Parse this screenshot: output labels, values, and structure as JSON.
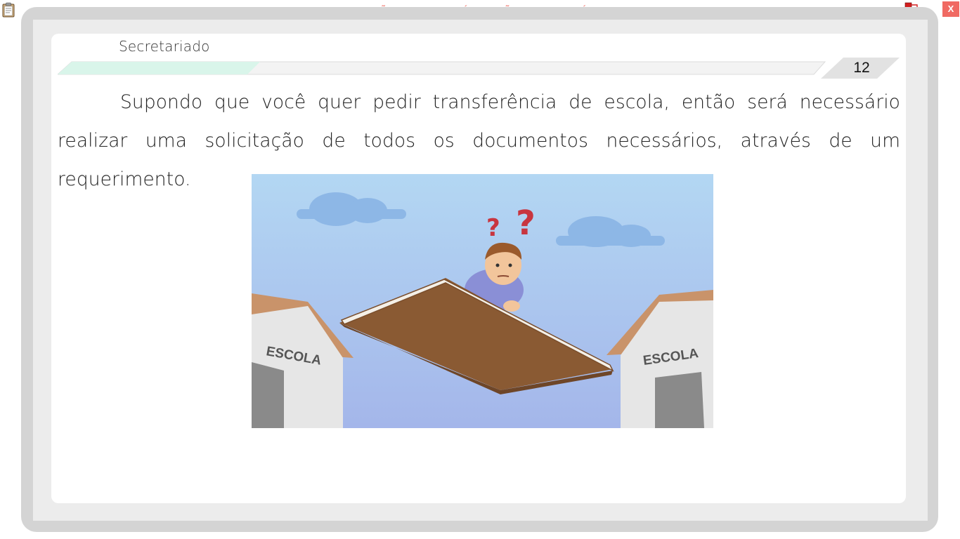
{
  "window": {
    "watermark": "VERSÃO PARA FUNCIONÁRIOS - NÃO COMERCIALIZÁVEL",
    "close_label": "X",
    "icons": [
      "clipboard-icon",
      "network-icon"
    ]
  },
  "page": {
    "subject": "Secretariado",
    "page_number": "12",
    "paragraph": "Supondo que você quer pedir transferência de escola, então será necessário realizar uma solicitação de todos os documentos necessários, através de um requerimento.",
    "illustration": {
      "left_building_label": "ESCOLA",
      "right_building_label": "ESCOLA",
      "question_marks": "? ?"
    }
  },
  "colors": {
    "accent_mint": "#d9f5ea",
    "watermark_red": "#f0776e",
    "close_red": "#f06a63",
    "sky": "#a9cdf0"
  }
}
